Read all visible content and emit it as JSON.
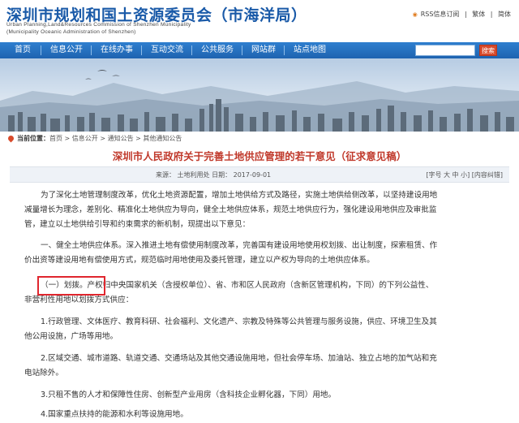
{
  "header": {
    "title": "深圳市规划和国土资源委员会（市海洋局）",
    "subtitle_line1": "Urban Planning,Land&Resources Commission of Shenzhen Municipality",
    "subtitle_line2": "(Municipality Oceanic Administration of Shenzhen)",
    "top_links": {
      "rss": "RSS信息订阅",
      "sep": "|",
      "traditional": "繁体",
      "simplified": "简体"
    }
  },
  "nav": {
    "items": [
      "首页",
      "信息公开",
      "在线办事",
      "互动交流",
      "公共服务",
      "网站群",
      "站点地图"
    ],
    "search_button": "搜索"
  },
  "breadcrumb": {
    "prefix": "当前位置：",
    "path": "首页 > 信息公开 > 通知公告 > 其他通知公告"
  },
  "article": {
    "title": "深圳市人民政府关于完善土地供应管理的若干意见（征求意见稿）",
    "meta": {
      "left": "来源： 土地利用处 日期： 2017-09-01",
      "right": "[字号 大 中 小]  [内容纠错]"
    },
    "paragraphs": [
      [
        "为了深化土地管理制度改革，优化土地资源配置，增加土地供给方式及路径，实施土地供给侧改革，以坚持建设用地",
        "减量增长为理念，差别化、精准化土地供应为导向，健全土地供应体系，规范土地供应行为，强化建设用地供应及审批监",
        "管，建立以土地供给引导和约束需求的新机制，现提出以下意见："
      ],
      [
        "一、健全土地供应体系。深入推进土地有偿使用制度改革，完善国有建设用地使用权划拨、出让制度，探索租赁、作",
        "价出资等建设用地有偿使用方式，规范临时用地使用及委托管理，建立以产权为导向的土地供应体系。"
      ],
      [
        "（一）划拨。产权归中央国家机关（含授权单位）、省、市和区人民政府（含新区管理机构，下同）的下列公益性、",
        "非营利性用地以划拨方式供应："
      ],
      [
        "1.行政管理、文体医疗、教育科研、社会福利、文化遗产、宗教及特殊等公共管理与服务设施，供应、环境卫生及其",
        "他公用设施，广场等用地。"
      ],
      [
        "2.区域交通、城市道路、轨道交通、交通场站及其他交通设施用地，但社会停车场、加油站、独立占地的加气站和充",
        "电站除外。"
      ],
      [
        "3.只租不售的人才和保障性住房、创新型产业用房（含科技企业孵化器，下同）用地。"
      ],
      [
        "4.国家重点扶持的能源和水利等设施用地。"
      ]
    ]
  }
}
